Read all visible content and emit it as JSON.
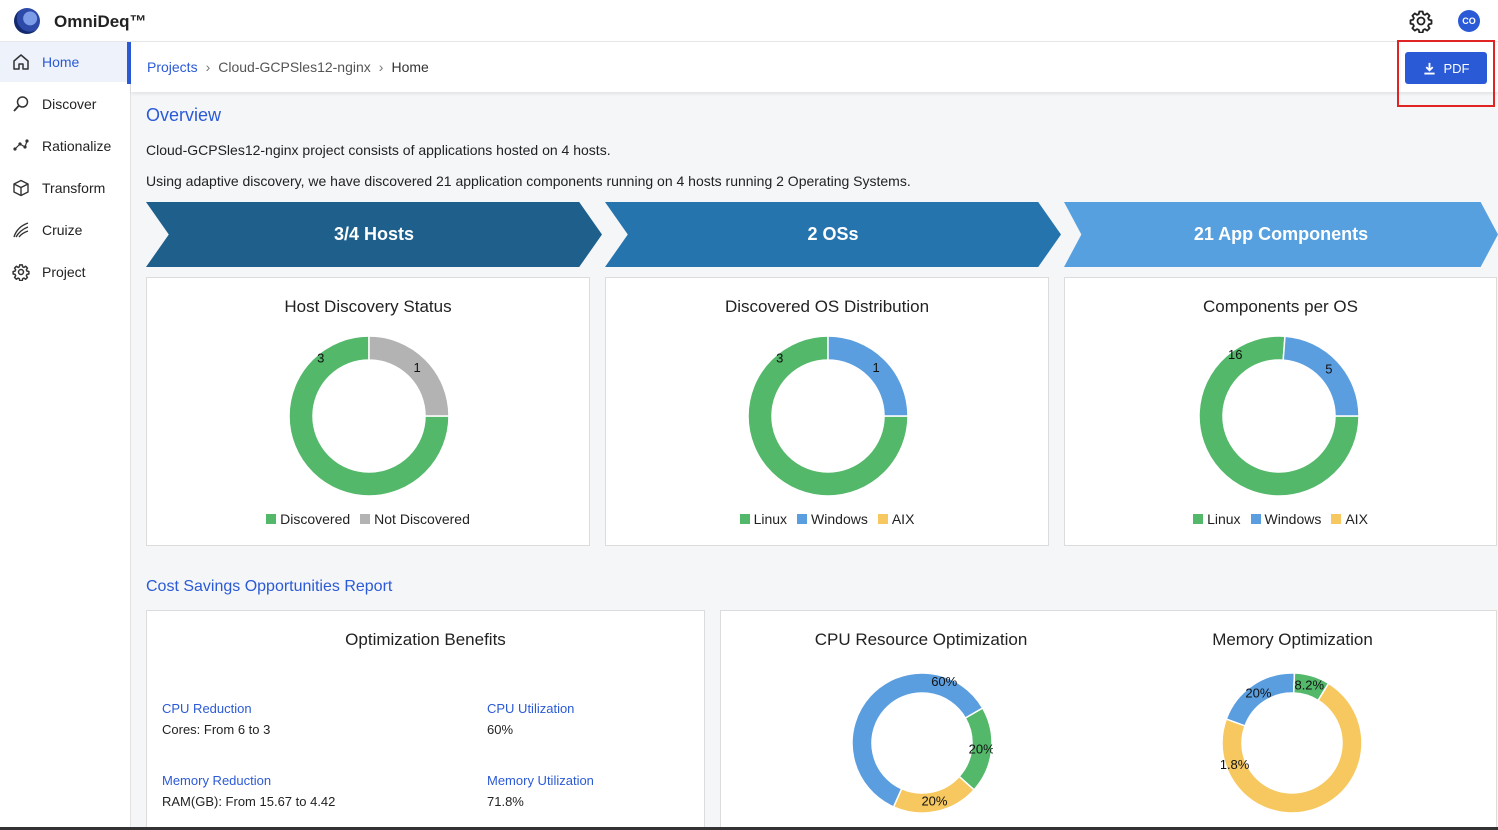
{
  "app": {
    "title": "OmniDeq™",
    "avatar_initials": "CO"
  },
  "sidebar": {
    "items": [
      {
        "label": "Home",
        "icon": "home-icon",
        "active": true
      },
      {
        "label": "Discover",
        "icon": "discover-icon"
      },
      {
        "label": "Rationalize",
        "icon": "rationalize-icon"
      },
      {
        "label": "Transform",
        "icon": "cube-icon"
      },
      {
        "label": "Cruize",
        "icon": "cruize-icon"
      },
      {
        "label": "Project",
        "icon": "gear-icon"
      }
    ]
  },
  "breadcrumb": {
    "projects": "Projects",
    "project": "Cloud-GCPSles12-nginx",
    "current": "Home"
  },
  "toolbar": {
    "pdf_label": "PDF"
  },
  "overview": {
    "title": "Overview",
    "line1": "Cloud-GCPSles12-nginx project consists of applications hosted on 4 hosts.",
    "line2": "Using adaptive discovery, we have discovered 21 application components running on 4 hosts running 2 Operating Systems."
  },
  "summary": {
    "hosts": "3/4 Hosts",
    "os": "2 OSs",
    "components": "21 App Components"
  },
  "colors": {
    "green": "#53b86a",
    "grey": "#b3b3b3",
    "blue": "#5b9ee0",
    "yellow": "#f6c85f",
    "accent": "#2b5ad6"
  },
  "chart_data": [
    {
      "type": "pie",
      "title": "Host Discovery Status",
      "categories": [
        "Discovered",
        "Not Discovered"
      ],
      "values": [
        3,
        1
      ],
      "labels": [
        "3",
        "1"
      ]
    },
    {
      "type": "pie",
      "title": "Discovered OS Distribution",
      "categories": [
        "Linux",
        "Windows",
        "AIX"
      ],
      "values": [
        3,
        1,
        0
      ],
      "labels": [
        "3",
        "1",
        ""
      ]
    },
    {
      "type": "pie",
      "title": "Components per OS",
      "categories": [
        "Linux",
        "Windows",
        "AIX"
      ],
      "values": [
        16,
        5,
        0
      ],
      "labels": [
        "16",
        "5",
        ""
      ]
    },
    {
      "type": "pie",
      "title": "CPU Resource Optimization",
      "values": [
        20,
        20,
        60
      ],
      "labels": [
        "20%",
        "20%",
        "60%"
      ]
    },
    {
      "type": "pie",
      "title": "Memory Optimization",
      "values": [
        20,
        8.2,
        71.8
      ],
      "labels": [
        "20%",
        "8.2%",
        "71.8%"
      ]
    }
  ],
  "cost": {
    "title": "Cost Savings Opportunities Report",
    "benefits_title": "Optimization Benefits",
    "cpu_reduction_label": "CPU Reduction",
    "cpu_reduction_value": "Cores: From 6 to 3",
    "cpu_util_label": "CPU Utilization",
    "cpu_util_value": "60%",
    "mem_reduction_label": "Memory Reduction",
    "mem_reduction_value": "RAM(GB): From 15.67 to 4.42",
    "mem_util_label": "Memory Utilization",
    "mem_util_value": "71.8%"
  }
}
